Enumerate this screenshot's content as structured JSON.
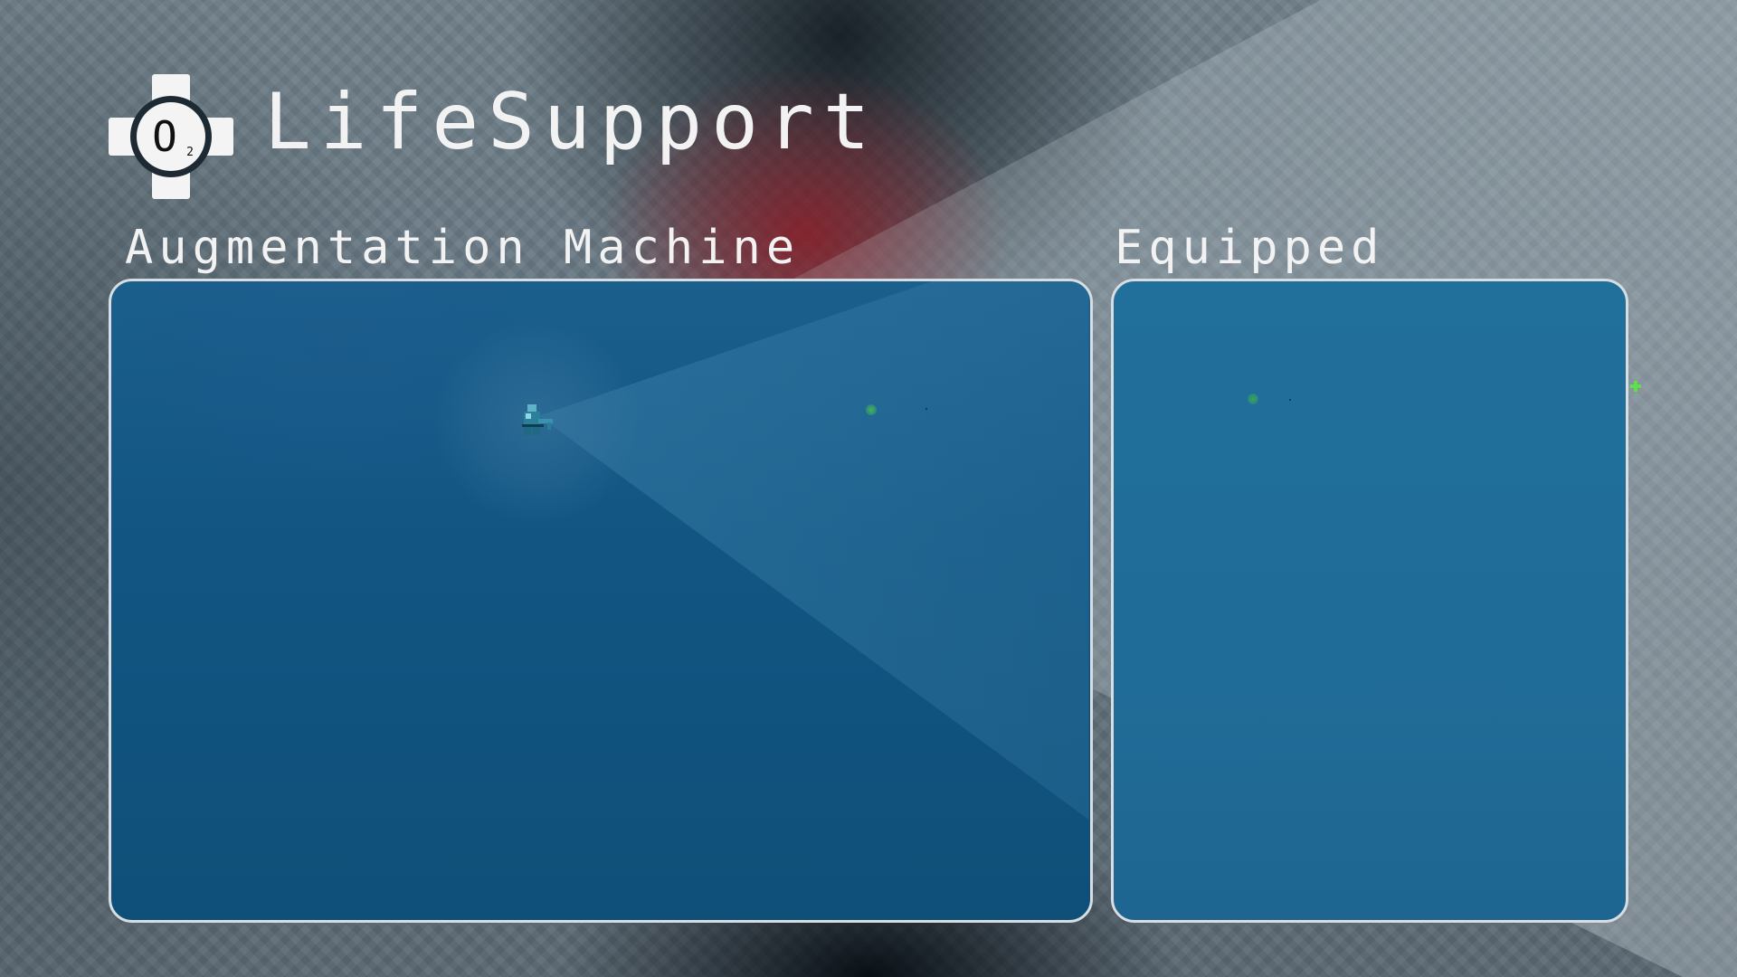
{
  "header": {
    "app_title": "LifeSupport",
    "logo_text": "O",
    "logo_subscript": "2",
    "logo_icon": "oxygen-icon"
  },
  "sections": {
    "machine_title": "Augmentation Machine",
    "equipped_title": "Equipped"
  },
  "colors": {
    "panel_fill": "#1b5f8d",
    "panel_border": "#d8dde2",
    "title_text": "#f2f2f2",
    "highlight_green": "#3fb35a",
    "marker_green": "#5ee04a",
    "red_glow": "#96141e"
  },
  "icons": {
    "player": "player-robot-icon",
    "pickup": "green-orb-icon",
    "edge_marker": "green-plus-marker-icon"
  }
}
